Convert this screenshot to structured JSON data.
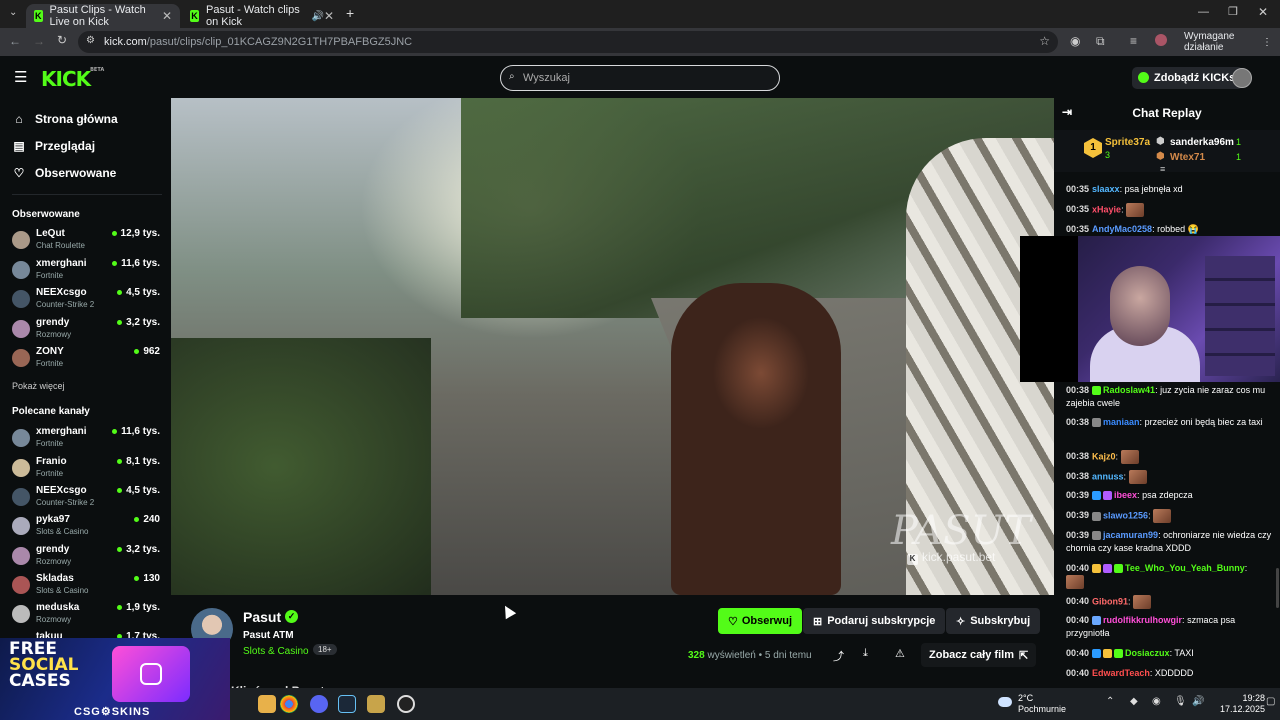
{
  "browser": {
    "tabs": [
      {
        "title": "Pasut Clips - Watch Live on Kick",
        "favicon": "kick-icon"
      },
      {
        "title": "Pasut - Watch clips on Kick",
        "favicon": "kick-icon",
        "audio": "speaker-icon"
      }
    ],
    "url_host": "kick.com",
    "url_path": "/pasut/clips/clip_01KCAGZ9N2G1TH7PBAFBGZ5JNC",
    "action_required": "Wymagane działanie"
  },
  "header": {
    "logo": "KICK",
    "logo_sup": "BETA",
    "search_placeholder": "Wyszukaj",
    "kicks_button": "Zdobądź KICKs"
  },
  "sidebar": {
    "nav": [
      {
        "label": "Strona główna",
        "icon": "home-icon"
      },
      {
        "label": "Przeglądaj",
        "icon": "browse-icon"
      },
      {
        "label": "Obserwowane",
        "icon": "heart-icon"
      }
    ],
    "followed_title": "Obserwowane",
    "followed": [
      {
        "name": "LeQut",
        "category": "Chat Roulette",
        "viewers": "12,9 tys."
      },
      {
        "name": "xmerghani",
        "category": "Fortnite",
        "viewers": "11,6 tys."
      },
      {
        "name": "NEEXcsgo",
        "category": "Counter-Strike 2",
        "viewers": "4,5 tys."
      },
      {
        "name": "grendy",
        "category": "Rozmowy",
        "viewers": "3,2 tys."
      },
      {
        "name": "ZONY",
        "category": "Fortnite",
        "viewers": "962"
      }
    ],
    "show_more": "Pokaż więcej",
    "recommended_title": "Polecane kanały",
    "recommended": [
      {
        "name": "xmerghani",
        "category": "Fortnite",
        "viewers": "11,6 tys."
      },
      {
        "name": "Franio",
        "category": "Fortnite",
        "viewers": "8,1 tys."
      },
      {
        "name": "NEEXcsgo",
        "category": "Counter-Strike 2",
        "viewers": "4,5 tys."
      },
      {
        "name": "pyka97",
        "category": "Slots & Casino",
        "viewers": "240"
      },
      {
        "name": "grendy",
        "category": "Rozmowy",
        "viewers": "3,2 tys."
      },
      {
        "name": "Skladas",
        "category": "Slots & Casino",
        "viewers": "130"
      },
      {
        "name": "meduska",
        "category": "Rozmowy",
        "viewers": "1,9 tys."
      },
      {
        "name": "takuu",
        "category": "",
        "viewers": "1,7 tys."
      }
    ]
  },
  "video": {
    "watermark": "PASUT",
    "watermark_url": "kick.pasut.bet"
  },
  "clip": {
    "channel": "Pasut",
    "title": "Pasut ATM",
    "category": "Slots & Casino",
    "age_badge": "18+",
    "follow": "Obserwuj",
    "gift": "Podaruj subskrypcje",
    "subscribe": "Subskrybuj",
    "views_count": "328",
    "views_label": "wyświetleń",
    "posted": "5 dni temu",
    "watch_full": "Zobacz cały film",
    "section_partial": "Klipów od Pasut"
  },
  "chat": {
    "title": "Chat Replay",
    "leaderboard": [
      {
        "rank": "1",
        "name": "Sprite37a",
        "count": "3"
      },
      {
        "name": "sanderka96m",
        "count": "1"
      },
      {
        "name": "Wtex71",
        "count": "1"
      }
    ],
    "messages": [
      {
        "time": "00:35",
        "user": "slaaxx",
        "color": "#53b7ff",
        "text": "psa jebnęła xd"
      },
      {
        "time": "00:35",
        "user": "xHayie",
        "color": "#ff4f6a",
        "text": "",
        "emote": true
      },
      {
        "time": "00:35",
        "user": "AndyMac0258",
        "color": "#5a9bff",
        "text": "robbed 😭"
      },
      {
        "time": "00:38",
        "user": "Radoslaw41",
        "color": "#53fc18",
        "text": "juz zycia nie zaraz cos mu zajebia cwele"
      },
      {
        "time": "00:38",
        "user": "maniaan",
        "color": "#3a8bff",
        "text": "przecież oni będą biec za taxi"
      },
      {
        "time": "00:38",
        "user": "Kajz0",
        "color": "#ffbf4d",
        "text": "",
        "emote": true
      },
      {
        "time": "00:38",
        "user": "annuss",
        "color": "#53b7ff",
        "text": "",
        "emote": true
      },
      {
        "time": "00:39",
        "user": "ibeex",
        "color": "#ff4fd8",
        "text": "psa zdepcza"
      },
      {
        "time": "00:39",
        "user": "slawo1256",
        "color": "#5a9bff",
        "text": "",
        "emote": true
      },
      {
        "time": "00:39",
        "user": "jacamuran99",
        "color": "#5a9bff",
        "text": "ochroniarze nie wiedza czy chornia czy kase kradna XDDD"
      },
      {
        "time": "00:40",
        "user": "Tee_Who_You_Yeah_Bunny",
        "color": "#53fc18",
        "text": "",
        "emote": true
      },
      {
        "time": "00:40",
        "user": "Gibon91",
        "color": "#ff6a6a",
        "text": "",
        "emote": true
      },
      {
        "time": "00:40",
        "user": "rudolfikkrulhowgir",
        "color": "#ff4fd8",
        "text": "szmaca psa przygniotła"
      },
      {
        "time": "00:40",
        "user": "Dosiaczux",
        "color": "#53fc18",
        "text": "TAXI"
      },
      {
        "time": "00:40",
        "user": "EdwardTeach",
        "color": "#ff4f4f",
        "text": "XDDDDD"
      }
    ]
  },
  "ad": {
    "line1": "FREE",
    "line2": "SOCIAL",
    "line3": "CASES",
    "brand": "CSG⚙SKINS"
  },
  "taskbar": {
    "weather_temp": "2°C",
    "weather_desc": "Pochmurnie",
    "time": "19:28",
    "date": "17.12.2025"
  }
}
